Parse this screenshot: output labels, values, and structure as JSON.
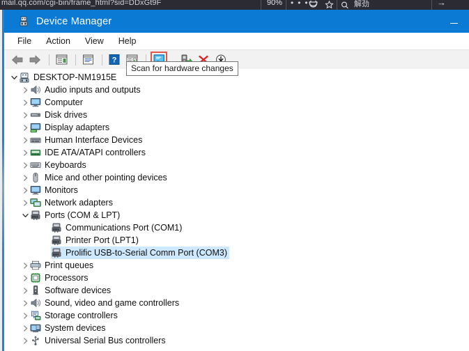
{
  "browser": {
    "url": "mail.qq.com/cgi-bin/frame_html?sid=DDxGt9F",
    "zoom": "90%",
    "menu_icon": "•••",
    "pocket_icon": "pocket-icon",
    "star_icon": "star-icon",
    "search_icon": "search-icon",
    "search_label": "解劲",
    "forward_arrow": "→"
  },
  "window": {
    "title": "Device Manager",
    "icon": "device-manager-icon",
    "minimize_label": "—"
  },
  "menubar": {
    "items": [
      {
        "label": "File",
        "name": "menu-file"
      },
      {
        "label": "Action",
        "name": "menu-action"
      },
      {
        "label": "View",
        "name": "menu-view"
      },
      {
        "label": "Help",
        "name": "menu-help"
      }
    ]
  },
  "toolbar": {
    "buttons": [
      {
        "name": "back-button",
        "icon": "back-arrow-icon",
        "title": "Back"
      },
      {
        "name": "forward-button",
        "icon": "forward-arrow-icon",
        "title": "Forward"
      },
      {
        "name": "show-hidden-devices-button",
        "icon": "list-view-icon",
        "title": "Show hidden devices"
      },
      {
        "name": "properties-button",
        "icon": "properties-icon",
        "title": "Properties"
      },
      {
        "name": "help-button",
        "icon": "help-question-icon",
        "title": "Help"
      },
      {
        "name": "view-devices-button",
        "icon": "device-list-icon",
        "title": "Devices by type"
      },
      {
        "name": "scan-for-hardware-changes-button",
        "icon": "scan-monitor-icon",
        "title": "Scan for hardware changes"
      },
      {
        "name": "update-driver-button",
        "icon": "update-driver-icon",
        "title": "Update driver"
      },
      {
        "name": "uninstall-device-button",
        "icon": "uninstall-x-icon",
        "title": "Uninstall device"
      },
      {
        "name": "disable-device-button",
        "icon": "disable-down-arrow-icon",
        "title": "Disable device"
      }
    ]
  },
  "tooltip": {
    "text": "Scan for hardware changes"
  },
  "tree": {
    "nodes": [
      {
        "label": "DESKTOP-NM1915E",
        "level": 0,
        "state": "expanded",
        "icon": "computer-root-icon",
        "selected": false
      },
      {
        "label": "Audio inputs and outputs",
        "level": 1,
        "state": "collapsed",
        "icon": "speaker-icon",
        "selected": false
      },
      {
        "label": "Computer",
        "level": 1,
        "state": "collapsed",
        "icon": "monitor-icon",
        "selected": false
      },
      {
        "label": "Disk drives",
        "level": 1,
        "state": "collapsed",
        "icon": "disk-drive-icon",
        "selected": false
      },
      {
        "label": "Display adapters",
        "level": 1,
        "state": "collapsed",
        "icon": "display-adapter-icon",
        "selected": false
      },
      {
        "label": "Human Interface Devices",
        "level": 1,
        "state": "collapsed",
        "icon": "hid-icon",
        "selected": false
      },
      {
        "label": "IDE ATA/ATAPI controllers",
        "level": 1,
        "state": "collapsed",
        "icon": "ide-controller-icon",
        "selected": false
      },
      {
        "label": "Keyboards",
        "level": 1,
        "state": "collapsed",
        "icon": "keyboard-icon",
        "selected": false
      },
      {
        "label": "Mice and other pointing devices",
        "level": 1,
        "state": "collapsed",
        "icon": "mouse-icon",
        "selected": false
      },
      {
        "label": "Monitors",
        "level": 1,
        "state": "collapsed",
        "icon": "monitor-icon",
        "selected": false
      },
      {
        "label": "Network adapters",
        "level": 1,
        "state": "collapsed",
        "icon": "network-adapter-icon",
        "selected": false
      },
      {
        "label": "Ports (COM & LPT)",
        "level": 1,
        "state": "expanded",
        "icon": "port-icon",
        "selected": false
      },
      {
        "label": "Communications Port (COM1)",
        "level": 2,
        "state": "leaf",
        "icon": "port-icon",
        "selected": false
      },
      {
        "label": "Printer Port (LPT1)",
        "level": 2,
        "state": "leaf",
        "icon": "port-icon",
        "selected": false
      },
      {
        "label": "Prolific USB-to-Serial Comm Port (COM3)",
        "level": 2,
        "state": "leaf",
        "icon": "port-icon",
        "selected": true
      },
      {
        "label": "Print queues",
        "level": 1,
        "state": "collapsed",
        "icon": "printer-icon",
        "selected": false
      },
      {
        "label": "Processors",
        "level": 1,
        "state": "collapsed",
        "icon": "processor-icon",
        "selected": false
      },
      {
        "label": "Software devices",
        "level": 1,
        "state": "collapsed",
        "icon": "software-device-icon",
        "selected": false
      },
      {
        "label": "Sound, video and game controllers",
        "level": 1,
        "state": "collapsed",
        "icon": "speaker-icon",
        "selected": false
      },
      {
        "label": "Storage controllers",
        "level": 1,
        "state": "collapsed",
        "icon": "storage-controller-icon",
        "selected": false
      },
      {
        "label": "System devices",
        "level": 1,
        "state": "collapsed",
        "icon": "system-device-icon",
        "selected": false
      },
      {
        "label": "Universal Serial Bus controllers",
        "level": 1,
        "state": "collapsed",
        "icon": "usb-icon",
        "selected": false
      }
    ]
  },
  "colors": {
    "titlebar": "#0a7ad4",
    "selection": "#cde8ff",
    "highlight_box": "#e2564a",
    "toolbar_bg": "#f2f2f2"
  }
}
